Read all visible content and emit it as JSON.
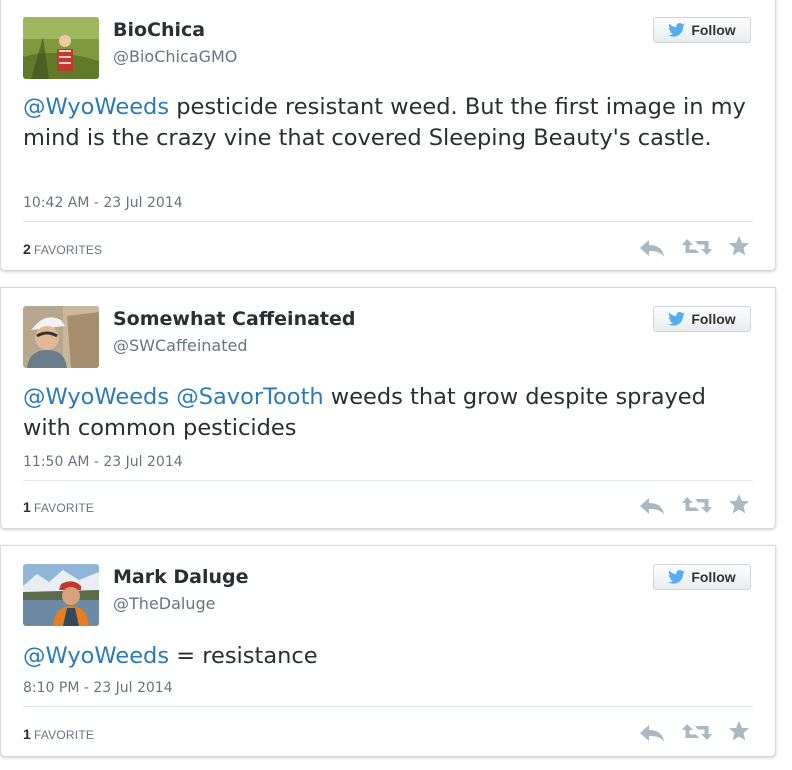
{
  "tweets": [
    {
      "name": "BioChica",
      "handle": "@BioChicaGMO",
      "follow_label": "Follow",
      "segments": [
        {
          "text": "@WyoWeeds",
          "mention": true
        },
        {
          "text": " pesticide resistant weed. But the first image in my mind is the crazy vine that covered Sleeping Beauty's castle.",
          "mention": false
        }
      ],
      "timestamp": "10:42 AM - 23 Jul 2014",
      "fav_count": "2",
      "fav_label": "FAVORITES"
    },
    {
      "name": "Somewhat Caffeinated",
      "handle": "@SWCaffeinated",
      "follow_label": "Follow",
      "segments": [
        {
          "text": "@WyoWeeds",
          "mention": true
        },
        {
          "text": " ",
          "mention": false
        },
        {
          "text": "@SavorTooth",
          "mention": true
        },
        {
          "text": " weeds that grow despite sprayed with common pesticides",
          "mention": false
        }
      ],
      "timestamp": "11:50 AM - 23 Jul 2014",
      "fav_count": "1",
      "fav_label": "FAVORITE"
    },
    {
      "name": "Mark Daluge",
      "handle": "@TheDaluge",
      "follow_label": "Follow",
      "segments": [
        {
          "text": "@WyoWeeds",
          "mention": true
        },
        {
          "text": " = resistance",
          "mention": false
        }
      ],
      "timestamp": "8:10 PM - 23 Jul 2014",
      "fav_count": "1",
      "fav_label": "FAVORITE"
    }
  ],
  "icons": {
    "follow_bird": "twitter-bird-icon",
    "reply": "reply-icon",
    "retweet": "retweet-icon",
    "favorite": "star-icon"
  },
  "colors": {
    "mention": "#2b7bb9",
    "bird": "#55acee",
    "action_icon": "#aab8c2"
  }
}
